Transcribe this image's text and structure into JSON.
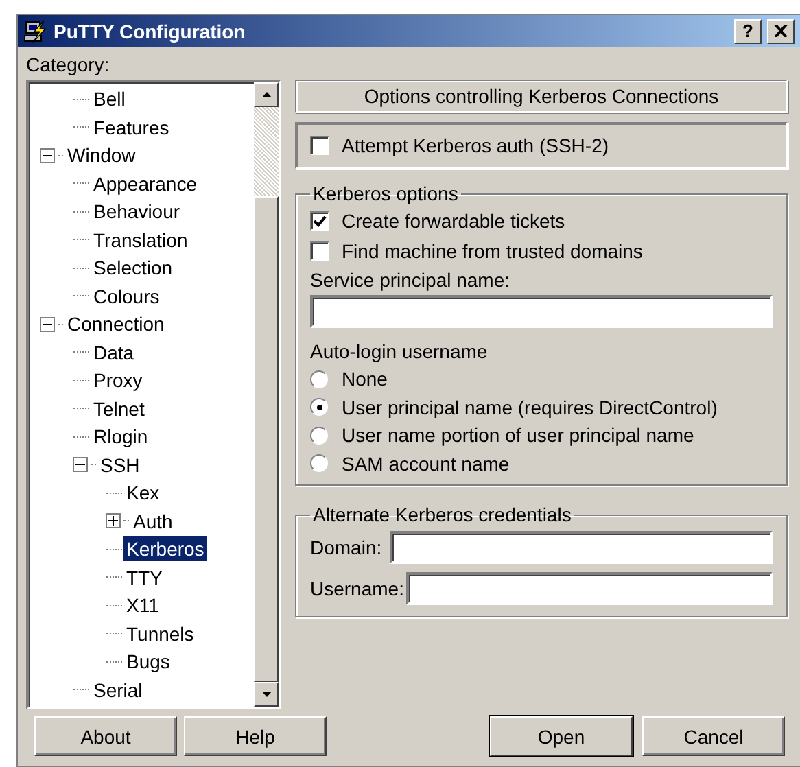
{
  "window": {
    "title": "PuTTY Configuration",
    "help_button": "?"
  },
  "category_label": "Category:",
  "tree": {
    "scrolled_items": [
      {
        "label": "Bell",
        "selected": false
      },
      {
        "label": "Features",
        "selected": false
      }
    ],
    "items": [
      {
        "label": "Window",
        "selected": false,
        "expanded": true,
        "children": [
          {
            "label": "Appearance",
            "selected": false
          },
          {
            "label": "Behaviour",
            "selected": false
          },
          {
            "label": "Translation",
            "selected": false
          },
          {
            "label": "Selection",
            "selected": false
          },
          {
            "label": "Colours",
            "selected": false
          }
        ]
      },
      {
        "label": "Connection",
        "selected": false,
        "expanded": true,
        "children": [
          {
            "label": "Data",
            "selected": false
          },
          {
            "label": "Proxy",
            "selected": false
          },
          {
            "label": "Telnet",
            "selected": false
          },
          {
            "label": "Rlogin",
            "selected": false
          },
          {
            "label": "SSH",
            "selected": false,
            "expanded": true,
            "children": [
              {
                "label": "Kex",
                "selected": false
              },
              {
                "label": "Auth",
                "selected": false,
                "expanded": false
              },
              {
                "label": "Kerberos",
                "selected": true
              },
              {
                "label": "TTY",
                "selected": false
              },
              {
                "label": "X11",
                "selected": false
              },
              {
                "label": "Tunnels",
                "selected": false
              },
              {
                "label": "Bugs",
                "selected": false
              }
            ]
          },
          {
            "label": "Serial",
            "selected": false
          }
        ]
      }
    ]
  },
  "panel_title": "Options controlling Kerberos Connections",
  "attempt_checkbox": {
    "label": "Attempt Kerberos auth (SSH-2)",
    "checked": false
  },
  "kerberos_options": {
    "title": "Kerberos options",
    "checkboxes": [
      {
        "label": "Create forwardable tickets",
        "checked": true
      },
      {
        "label": "Find machine from trusted domains",
        "checked": false
      }
    ],
    "service_label": "Service principal name:",
    "autologin_label": "Auto-login username",
    "radios": [
      {
        "label": "None",
        "selected": false
      },
      {
        "label": "User principal name (requires DirectControl)",
        "selected": true
      },
      {
        "label": "User name portion of user principal name",
        "selected": false
      },
      {
        "label": "SAM account name",
        "selected": false
      }
    ]
  },
  "alternate_credentials": {
    "title": "Alternate Kerberos credentials",
    "fields": [
      {
        "label": "Domain:"
      },
      {
        "label": "Username:"
      }
    ]
  },
  "buttons": [
    {
      "label": "About",
      "default": false
    },
    {
      "label": "Help",
      "default": false
    },
    {
      "label": "Open",
      "default": true
    },
    {
      "label": "Cancel",
      "default": false
    }
  ]
}
